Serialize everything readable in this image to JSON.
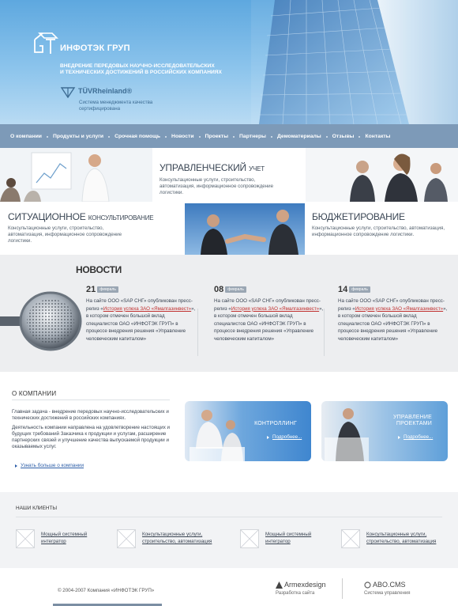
{
  "header": {
    "company": "ИНФОТЭК ГРУП",
    "tagline_line1": "ВНЕДРЕНИЕ ПЕРЕДОВЫХ НАУЧНО-ИССЛЕДОВАТЕЛЬСКИХ",
    "tagline_line2": "И ТЕХНИЧЕСКИХ ДОСТИЖЕНИЙ В РОССИЙСКИХ КОМПАНИЯХ",
    "cert_brand": "TÜVRheinland®",
    "cert_line1": "Система менеджмента качества",
    "cert_line2": "сертифицирована"
  },
  "nav": {
    "items": [
      "О компании",
      "Продукты и услуги",
      "Срочная помощь",
      "Новости",
      "Проекты",
      "Партнеры",
      "Демоматериалы",
      "Отзывы",
      "Контакты"
    ]
  },
  "services": {
    "accounting": {
      "title_big": "УПРАВЛЕНЧЕСКИЙ",
      "title_small": "УЧЕТ",
      "desc": "Консультационные услуги, строительство, автоматизация, информационное сопровождение логистики."
    },
    "consulting": {
      "title_big": "СИТУАЦИОННОЕ",
      "title_small": "КОНСУЛЬТИРОВАНИЕ",
      "desc": "Консультационные услуги, строительство, автоматизация, информационное сопровождение логистики."
    },
    "budgeting": {
      "title_big": "БЮДЖЕТИРОВАНИЕ",
      "desc": "Консультационные услуги, строительство, автоматизация, информационное сопровождение логистики."
    }
  },
  "news": {
    "title": "НОВОСТИ",
    "items": [
      {
        "day": "21",
        "month": "февраль",
        "text_before": "На сайте ООО «SAP СНГ» опубликован пресс-релиз «",
        "link": "История успеха ЗАО «Ямалгазинвест»",
        "text_after": "», в котором отмечен большой вклад специалистов ОАО «ИНФОТЭК ГРУП» в процессе внедрения решения «Управление человеческим капиталом»"
      },
      {
        "day": "08",
        "month": "февраль",
        "text_before": "На сайте ООО «SAP СНГ» опубликован пресс-релиз «",
        "link": "История успеха ЗАО «Ямалгазинвест»",
        "text_after": "», в котором отмечен большой вклад специалистов ОАО «ИНФОТЭК ГРУП» в процессе внедрения решения «Управление человеческим капиталом»"
      },
      {
        "day": "14",
        "month": "февраль",
        "text_before": "На сайте ООО «SAP СНГ» опубликован пресс-релиз «",
        "link": "История успеха ЗАО «Ямалгазинвест»",
        "text_after": "», в котором отмечен большой вклад специалистов ОАО «ИНФОТЭК ГРУП» в процессе внедрения решения «Управление человеческим капиталом»"
      }
    ]
  },
  "about": {
    "title": "О КОМПАНИИ",
    "para1": "Главная задача - внедрение передовых научно-исследовательских и технических достижений в российских компаниях.",
    "para2": "Деятельность компании направлена на удовлетворение настоящих и будущих требований Заказчика к продукции и услугам, расширение партнерских связей и улучшение качества выпускаемой продукции и оказываемых услуг.",
    "more_link": "Узнать больше о компании"
  },
  "promos": [
    {
      "title": "КОНТРОЛЛИНГ",
      "link": "Подробнее..."
    },
    {
      "title_line1": "УПРАВЛЕНИЕ",
      "title_line2": "ПРОЕКТАМИ",
      "link": "Подробнее..."
    }
  ],
  "clients": {
    "title": "НАШИ КЛИЕНТЫ",
    "items": [
      {
        "line1": "Мощный системный",
        "line2": "интегратор"
      },
      {
        "line1": "Консультационные услуги,",
        "line2": "строительство, автоматизация"
      },
      {
        "line1": "Мощный системный",
        "line2": "интегратор"
      },
      {
        "line1": "Консультационные услуги,",
        "line2": "строительство, автоматизация"
      }
    ]
  },
  "footer": {
    "copyright": "© 2004-2007 Компания «ИНФОТЭК ГРУП»",
    "dev1_name": "Armexdesign",
    "dev1_caption": "Разработка сайта",
    "dev2_name": "ABO.CMS",
    "dev2_caption": "Система управления"
  },
  "colors": {
    "nav_bg": "#7d9ab8",
    "header_sky": "#5ea8df",
    "link_red": "#c0302f",
    "link_blue": "#2e5fa8"
  }
}
